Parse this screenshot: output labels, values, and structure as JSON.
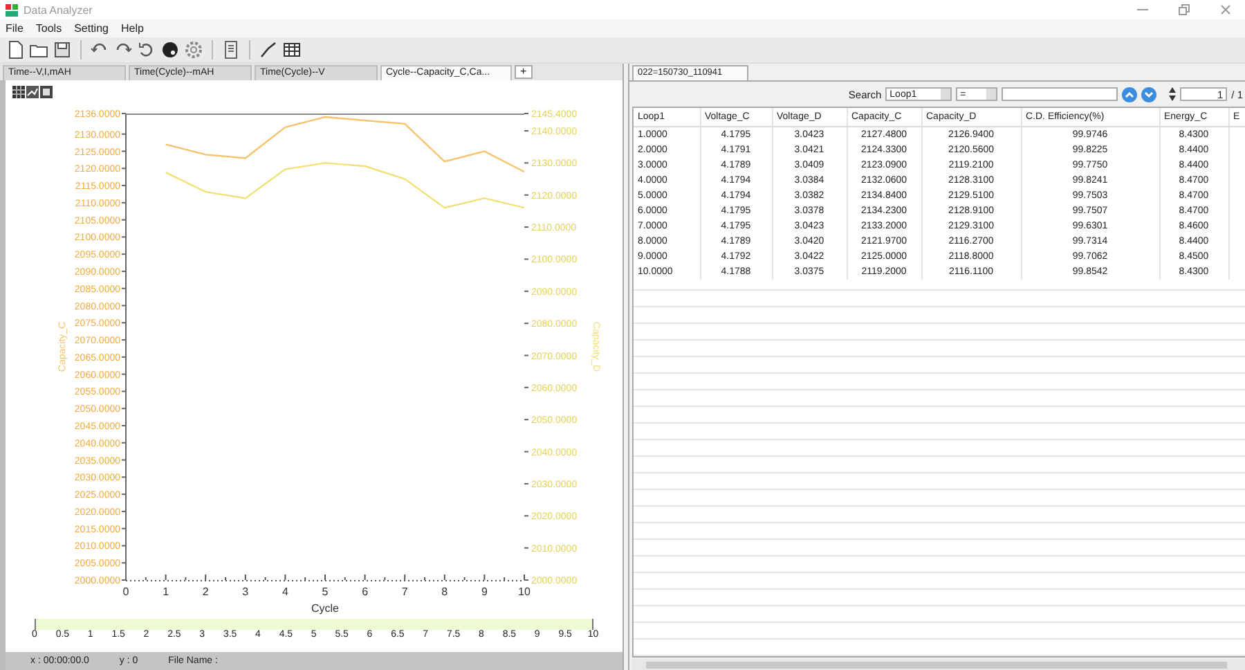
{
  "window": {
    "title": "Data Analyzer"
  },
  "menu": [
    "File",
    "Tools",
    "Setting",
    "Help"
  ],
  "chart_tabs": [
    {
      "label": "Time--V,I,mAH",
      "selected": false
    },
    {
      "label": "Time(Cycle)--mAH",
      "selected": false
    },
    {
      "label": "Time(Cycle)--V",
      "selected": false
    },
    {
      "label": "Cycle--Capacity_C,Ca...",
      "selected": true
    }
  ],
  "add_tab": "+",
  "chart": {
    "chart_data": {
      "type": "line",
      "xlabel": "Cycle",
      "x": [
        1,
        2,
        3,
        4,
        5,
        6,
        7,
        8,
        9,
        10
      ],
      "series": [
        {
          "name": "Capacity_C",
          "color": "#f6c46e",
          "values": [
            2127,
            2124,
            2123,
            2132,
            2135,
            2134,
            2133,
            2122,
            2125,
            2119
          ]
        },
        {
          "name": "Capacity_D",
          "color": "#f2e07a",
          "axis": "y2",
          "values": [
            2127,
            2121,
            2119,
            2128,
            2130,
            2129,
            2125,
            2116,
            2119,
            2116
          ]
        }
      ],
      "xlim": [
        0,
        10
      ],
      "ylim": [
        2000,
        2136
      ],
      "y2lim": [
        2000,
        2145.4
      ],
      "xticks": [
        0,
        1,
        2,
        3,
        4,
        5,
        6,
        7,
        8,
        9,
        10
      ],
      "yticks": [
        {
          "value": 2000,
          "label": "2000.0000"
        },
        {
          "value": 2005,
          "label": "2005.0000"
        },
        {
          "value": 2010,
          "label": "2010.0000"
        },
        {
          "value": 2015,
          "label": "2015.0000"
        },
        {
          "value": 2020,
          "label": "2020.0000"
        },
        {
          "value": 2025,
          "label": "2025.0000"
        },
        {
          "value": 2030,
          "label": "2030.0000"
        },
        {
          "value": 2035,
          "label": "2035.0000"
        },
        {
          "value": 2040,
          "label": "2040.0000"
        },
        {
          "value": 2045,
          "label": "2045.0000"
        },
        {
          "value": 2050,
          "label": "2050.0000"
        },
        {
          "value": 2055,
          "label": "2055.0000"
        },
        {
          "value": 2060,
          "label": "2060.0000"
        },
        {
          "value": 2065,
          "label": "2065.0000"
        },
        {
          "value": 2070,
          "label": "2070.0000"
        },
        {
          "value": 2075,
          "label": "2075.0000"
        },
        {
          "value": 2080,
          "label": "2080.0000"
        },
        {
          "value": 2085,
          "label": "2085.0000"
        },
        {
          "value": 2090,
          "label": "2090.0000"
        },
        {
          "value": 2095,
          "label": "2095.0000"
        },
        {
          "value": 2100,
          "label": "2100.0000"
        },
        {
          "value": 2105,
          "label": "2105.0000"
        },
        {
          "value": 2110,
          "label": "2110.0000"
        },
        {
          "value": 2115,
          "label": "2115.0000"
        },
        {
          "value": 2120,
          "label": "2120.0000"
        },
        {
          "value": 2125,
          "label": "2125.0000"
        },
        {
          "value": 2130,
          "label": "2130.0000"
        },
        {
          "value": 2136,
          "label": "2136.0000"
        }
      ],
      "y2ticks": [
        {
          "value": 2000,
          "label": "2000.0000"
        },
        {
          "value": 2010,
          "label": "2010.0000"
        },
        {
          "value": 2020,
          "label": "2020.0000"
        },
        {
          "value": 2030,
          "label": "2030.0000"
        },
        {
          "value": 2040,
          "label": "2040.0000"
        },
        {
          "value": 2050,
          "label": "2050.0000"
        },
        {
          "value": 2060,
          "label": "2060.0000"
        },
        {
          "value": 2070,
          "label": "2070.0000"
        },
        {
          "value": 2080,
          "label": "2080.0000"
        },
        {
          "value": 2090,
          "label": "2090.0000"
        },
        {
          "value": 2100,
          "label": "2100.0000"
        },
        {
          "value": 2110,
          "label": "2110.0000"
        },
        {
          "value": 2120,
          "label": "2120.0000"
        },
        {
          "value": 2130,
          "label": "2130.0000"
        },
        {
          "value": 2140,
          "label": "2140.0000"
        },
        {
          "value": 2145.4,
          "label": "2145.4000"
        }
      ]
    }
  },
  "range_slider": {
    "level": 1,
    "labels": [
      "0",
      "0.5",
      "1",
      "1.5",
      "2",
      "2.5",
      "3",
      "3.5",
      "4",
      "4.5",
      "5",
      "5.5",
      "6",
      "6.5",
      "7",
      "7.5",
      "8",
      "8.5",
      "9",
      "9.5",
      "10"
    ]
  },
  "status_bar": {
    "x": "x : 00:00:00.0",
    "y": "y : 0",
    "file": "File Name :"
  },
  "data_tab": "022=150730_110941",
  "search": {
    "label": "Search",
    "field": "Loop1",
    "operator": "=",
    "page": "1",
    "total": "/ 1"
  },
  "table": {
    "columns": [
      "Loop1",
      "Voltage_C",
      "Voltage_D",
      "Capacity_C",
      "Capacity_D",
      "C.D. Efficiency(%)",
      "Energy_C",
      "E"
    ],
    "rows": [
      [
        "1.0000",
        "4.1795",
        "3.0423",
        "2127.4800",
        "2126.9400",
        "99.9746",
        "8.4300"
      ],
      [
        "2.0000",
        "4.1791",
        "3.0421",
        "2124.3300",
        "2120.5600",
        "99.8225",
        "8.4400"
      ],
      [
        "3.0000",
        "4.1789",
        "3.0409",
        "2123.0900",
        "2119.2100",
        "99.7750",
        "8.4400"
      ],
      [
        "4.0000",
        "4.1794",
        "3.0384",
        "2132.0600",
        "2128.3100",
        "99.8241",
        "8.4700"
      ],
      [
        "5.0000",
        "4.1794",
        "3.0382",
        "2134.8400",
        "2129.5100",
        "99.7503",
        "8.4700"
      ],
      [
        "6.0000",
        "4.1795",
        "3.0378",
        "2134.2300",
        "2128.9100",
        "99.7507",
        "8.4700"
      ],
      [
        "7.0000",
        "4.1795",
        "3.0423",
        "2133.2000",
        "2129.3100",
        "99.6301",
        "8.4600"
      ],
      [
        "8.0000",
        "4.1789",
        "3.0420",
        "2121.9700",
        "2116.2700",
        "99.7314",
        "8.4400"
      ],
      [
        "9.0000",
        "4.1792",
        "3.0422",
        "2125.0000",
        "2118.8000",
        "99.7062",
        "8.4500"
      ],
      [
        "10.0000",
        "4.1788",
        "3.0375",
        "2119.2000",
        "2116.1100",
        "99.8542",
        "8.4300"
      ]
    ]
  }
}
